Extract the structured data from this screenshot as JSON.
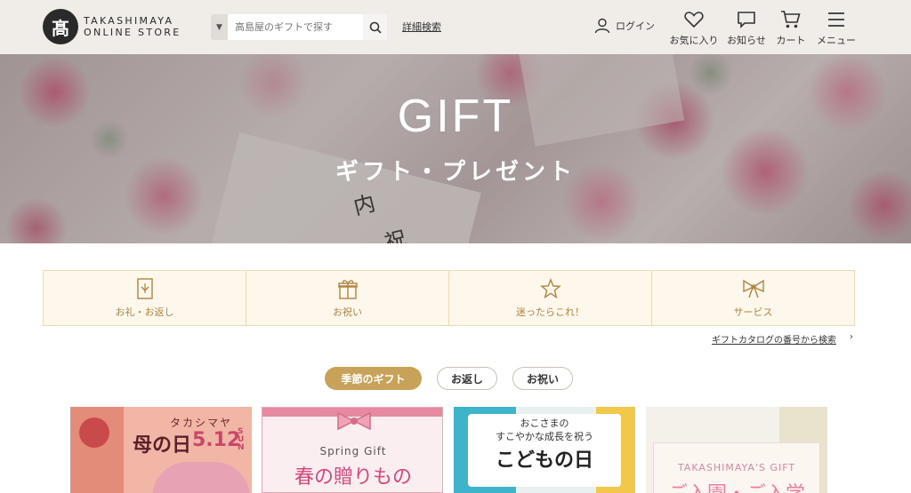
{
  "header": {
    "logo_mark": "髙",
    "logo_line1": "TAKASHIMAYA",
    "logo_line2": "ONLINE STORE",
    "search_placeholder": "高島屋のギフトで探す",
    "detail_search": "詳細検索",
    "login": "ログイン",
    "icons": [
      {
        "icon": "heart-icon",
        "label": "お気に入り"
      },
      {
        "icon": "chat-icon",
        "label": "お知らせ"
      },
      {
        "icon": "cart-icon",
        "label": "カート"
      },
      {
        "icon": "menu-icon",
        "label": "メニュー"
      }
    ]
  },
  "hero": {
    "title": "GIFT",
    "subtitle": "ギフト・プレゼント",
    "kanji1": "内",
    "kanji2": "祝"
  },
  "categories": [
    {
      "icon": "gift-card-icon",
      "label": "お礼・お返し"
    },
    {
      "icon": "present-icon",
      "label": "お祝い"
    },
    {
      "icon": "star-icon",
      "label": "迷ったらこれ！"
    },
    {
      "icon": "ribbon-icon",
      "label": "サービス"
    }
  ],
  "catalog_link": "ギフトカタログの番号から検索",
  "tabs": [
    {
      "label": "季節のギフト",
      "active": true
    },
    {
      "label": "お返し",
      "active": false
    },
    {
      "label": "お祝い",
      "active": false
    }
  ],
  "cards": [
    {
      "top": "タカシマヤ",
      "main": "母の日",
      "date": "5.12",
      "suffix": "SUN"
    },
    {
      "top": "Spring Gift",
      "main": "春の贈りもの"
    },
    {
      "top": "おこさまの",
      "top2": "すこやかな成長を祝う",
      "main": "こどもの日"
    },
    {
      "top": "TAKASHIMAYA'S GIFT",
      "main": "ご入園・ご入学"
    }
  ],
  "colors": {
    "header_bg": "#f0ece8",
    "accent_gold": "#c9a25a",
    "category_bg": "#fdf7ec",
    "category_text": "#b08440"
  }
}
